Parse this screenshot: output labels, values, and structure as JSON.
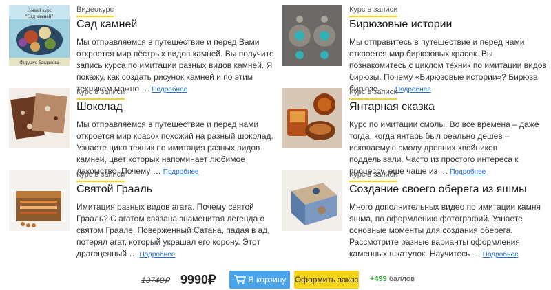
{
  "courses": [
    {
      "category": "Видеокурс",
      "title": "Сад камней",
      "description": "Мы отправляемся в путешествие и перед Вами откроется мир пёстрых видов камней. Вы получите запись курса по имитации разных видов камней. Я покажу, как создать рисунок камней и по этим техникам можно …",
      "more": "Подробнее",
      "thumb_caption_top": "Новый курс",
      "thumb_caption_mid": "“Сад камней”",
      "thumb_caption_bottom": "Фирдаус Батдалова"
    },
    {
      "category": "Курс в записи",
      "title": "Бирюзовые истории",
      "description": "Мы отправитесь в путешествие и перед нами откроется мир бирюзовых красок. Вы познакомитесь с циклом техник по имитации видов бирюзы. Почему «Бирюзовые истории»? Бирюза бирюзе - …",
      "more": "Подробнее"
    },
    {
      "category": "Курс в записи",
      "title": "Шоколад",
      "description": "Мы отправляемся в путешествие и перед нами откроется мир красок похожий на разный шоколад. Узнаете цикл техник по имитация разных видов камней, цвет которых напоминает любимое лакомство. Почему …",
      "more": "Подробнее"
    },
    {
      "category": "Курс в записи",
      "title": "Янтарная сказка",
      "description": "Курс по имитации смолы. Во все времена – даже тогда, когда янтарь был реально дешев – ископаемую смолу древних хвойников подделывали. Часто из простого интереса к процессу, еще чаще из …",
      "more": "Подробнее"
    },
    {
      "category": "Курс в записи",
      "title": "Святой Грааль",
      "description": "Имитация разных видов агата. Почему святой Грааль? С агатом связана знаменитая легенда о святом Граале. Поверженный Сатана, падая в ад, потерял агат, который украшал его корону. Этот драгоценный …",
      "more": "Подробнее"
    },
    {
      "category": "Курс в записи",
      "title": "Создание своего оберега из яшмы",
      "description": "Много дополнительных видео по имитации камня яшма, по оформлению фотографий. Узнаете основные моменты для создания оберега. Рассмотрите разные варианты оформления каменных шкатулок. Научитесь …",
      "more": "Подробнее"
    }
  ],
  "footer": {
    "old_price": "13740₽",
    "price": "9990₽",
    "cart_label": "В корзину",
    "order_label": "Оформить заказ",
    "bonus_amount": "+499",
    "bonus_label": "баллов"
  },
  "colors": {
    "accent_yellow": "#f5d41c",
    "cart_blue": "#4aa3e8",
    "link_blue": "#1f6fd6",
    "bonus_green": "#3a9a3a"
  },
  "icons": {
    "cart": "cart-icon"
  }
}
